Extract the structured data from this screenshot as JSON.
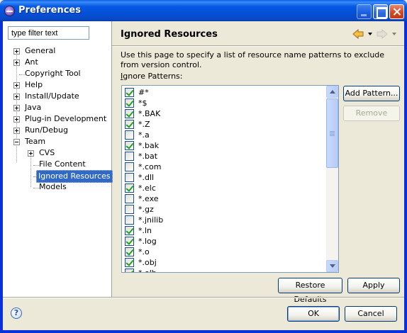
{
  "window": {
    "title": "Preferences"
  },
  "filter": {
    "placeholder": "type filter text",
    "value": "type filter text"
  },
  "tree": [
    {
      "label": "General"
    },
    {
      "label": "Ant"
    },
    {
      "label": "Copyright Tool"
    },
    {
      "label": "Help"
    },
    {
      "label": "Install/Update"
    },
    {
      "label": "Java"
    },
    {
      "label": "Plug-in Development"
    },
    {
      "label": "Run/Debug"
    },
    {
      "label": "Team"
    },
    {
      "label": "CVS"
    },
    {
      "label": "File Content"
    },
    {
      "label": "Ignored Resources"
    },
    {
      "label": "Models"
    }
  ],
  "page": {
    "title": "Ignored Resources",
    "description": "Use this page to specify a list of resource name patterns to exclude from version control.",
    "ignore_label_prefix": "I",
    "ignore_label_rest": "gnore Patterns:"
  },
  "patterns": [
    {
      "text": "#*",
      "checked": true
    },
    {
      "text": "*$",
      "checked": true
    },
    {
      "text": "*.BAK",
      "checked": true
    },
    {
      "text": "*.Z",
      "checked": true
    },
    {
      "text": "*.a",
      "checked": false
    },
    {
      "text": "*.bak",
      "checked": true
    },
    {
      "text": "*.bat",
      "checked": false
    },
    {
      "text": "*.com",
      "checked": false
    },
    {
      "text": "*.dll",
      "checked": false
    },
    {
      "text": "*.elc",
      "checked": true
    },
    {
      "text": "*.exe",
      "checked": false
    },
    {
      "text": "*.gz",
      "checked": false
    },
    {
      "text": "*.jnilib",
      "checked": false
    },
    {
      "text": "*.ln",
      "checked": true
    },
    {
      "text": "*.log",
      "checked": true
    },
    {
      "text": "*.o",
      "checked": true
    },
    {
      "text": "*.obj",
      "checked": true
    },
    {
      "text": "*.olb",
      "checked": true
    }
  ],
  "buttons": {
    "add_pattern": "Add Pattern...",
    "remove": "Remove",
    "restore_defaults": "Restore Defaults",
    "apply": "Apply",
    "ok": "OK",
    "cancel": "Cancel"
  },
  "icons": {
    "help": "?"
  },
  "colors": {
    "selection": "#316ac5",
    "titlebar": "#0451d8"
  }
}
